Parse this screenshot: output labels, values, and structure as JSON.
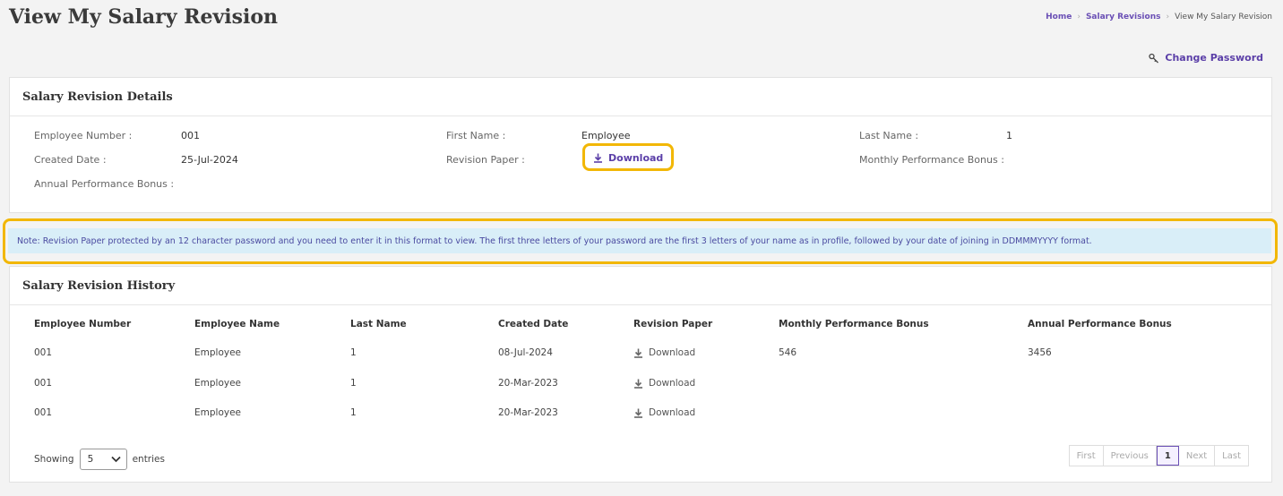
{
  "page": {
    "title": "View My Salary Revision",
    "breadcrumb": [
      "Home",
      "Salary Revisions",
      "View My Salary Revision"
    ],
    "change_password": "Change Password"
  },
  "details": {
    "header": "Salary Revision Details",
    "employee_number_label": "Employee Number :",
    "employee_number": "001",
    "first_name_label": "First Name :",
    "first_name": "Employee",
    "last_name_label": "Last Name :",
    "last_name": "1",
    "created_date_label": "Created Date :",
    "created_date": "25-Jul-2024",
    "revision_paper_label": "Revision Paper :",
    "download_label": "Download",
    "monthly_bonus_label": "Monthly Performance Bonus :",
    "annual_bonus_label": "Annual Performance Bonus :"
  },
  "note": "Note: Revision Paper protected by an 12 character password and you need to enter it in this format to view. The first three letters of your password are the first 3 letters of your name as in profile, followed by your date of joining in DDMMMYYYY format.",
  "history": {
    "header": "Salary Revision History",
    "columns": [
      "Employee Number",
      "Employee Name",
      "Last Name",
      "Created Date",
      "Revision Paper",
      "Monthly Performance Bonus",
      "Annual Performance Bonus"
    ],
    "rows": [
      {
        "emp_no": "001",
        "emp_name": "Employee",
        "last_name": "1",
        "created": "08-Jul-2024",
        "paper": "Download",
        "monthly": "546",
        "annual": "3456"
      },
      {
        "emp_no": "001",
        "emp_name": "Employee",
        "last_name": "1",
        "created": "20-Mar-2023",
        "paper": "Download",
        "monthly": "",
        "annual": ""
      },
      {
        "emp_no": "001",
        "emp_name": "Employee",
        "last_name": "1",
        "created": "20-Mar-2023",
        "paper": "Download",
        "monthly": "",
        "annual": ""
      }
    ],
    "showing_label": "Showing",
    "entries_value": "5",
    "entries_label": "entries",
    "pager": {
      "first": "First",
      "previous": "Previous",
      "current": "1",
      "next": "Next",
      "last": "Last"
    }
  },
  "colors": {
    "accent": "#5b3fa8",
    "highlight": "#f2b705",
    "note_bg": "#d9eef8"
  }
}
